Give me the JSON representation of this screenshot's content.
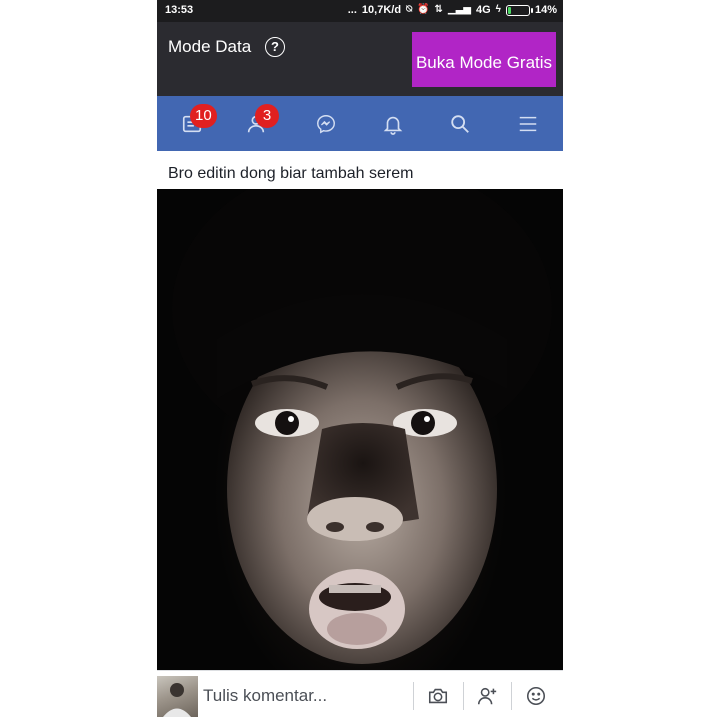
{
  "status_bar": {
    "time": "13:53",
    "dots": "...",
    "network_speed": "10,7K/d",
    "network_type": "4G",
    "battery": "14%",
    "battery_level": 0.14
  },
  "data_bar": {
    "mode_label": "Mode Data",
    "help_icon": "question-circle-icon",
    "free_mode_button": "Buka Mode Gratis"
  },
  "nav": {
    "items": [
      {
        "icon": "news-feed-icon",
        "badge": "10"
      },
      {
        "icon": "friend-requests-icon",
        "badge": "3"
      },
      {
        "icon": "messenger-icon"
      },
      {
        "icon": "notifications-bell-icon"
      },
      {
        "icon": "search-icon"
      },
      {
        "icon": "menu-icon"
      }
    ]
  },
  "post": {
    "caption": "Bro editin dong biar tambah serem"
  },
  "comment_bar": {
    "placeholder": "Tulis komentar...",
    "icons": [
      "camera-icon",
      "tag-friend-icon",
      "emoji-icon"
    ]
  },
  "colors": {
    "nav_bar": "#4267b2",
    "data_bar": "#2b2b30",
    "free_mode_button": "#b125c6",
    "badge": "#e02020"
  }
}
